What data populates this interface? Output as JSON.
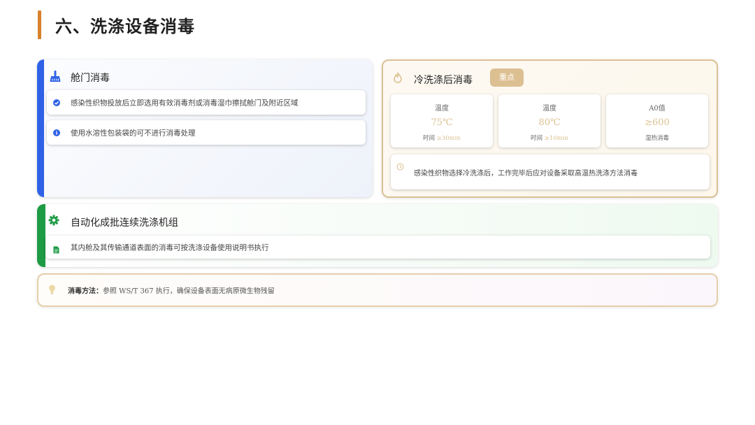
{
  "page": {
    "title": "六、洗涤设备消毒"
  },
  "hatch": {
    "title": "舱门消毒",
    "items": [
      {
        "text": "感染性织物投放后立即选用有效消毒剂或消毒湿巾擦拭舱门及附近区域"
      },
      {
        "text": "使用水溶性包装袋的可不进行消毒处理"
      }
    ]
  },
  "hot": {
    "title": "冷洗涤后消毒",
    "badge": "重点",
    "metrics": [
      {
        "label": "温度",
        "value": "75℃",
        "sub_label": "时间",
        "sub_value": "≥30min"
      },
      {
        "label": "温度",
        "value": "80℃",
        "sub_label": "时间",
        "sub_value": "≥10min"
      },
      {
        "label": "A0值",
        "value": "≥600",
        "sub_label": "湿热消毒",
        "sub_value": ""
      }
    ],
    "note": "感染性织物选择冷洗涤后，工作完毕后应对设备采取高温热洗涤方法消毒"
  },
  "auto": {
    "title": "自动化成批连续洗涤机组",
    "item": "其内舱及其传输通道表面的消毒可按洗涤设备使用说明书执行"
  },
  "method": {
    "label": "消毒方法：",
    "text": "参照 WS/T 367 执行，确保设备表面无病原微生物残留"
  },
  "colors": {
    "accent_orange": "#d8822b",
    "blue": "#2f62e6",
    "green": "#1e9b45",
    "gold": "#dcc092"
  },
  "icons": [
    "broom-icon",
    "check-circle-icon",
    "info-circle-icon",
    "fire-icon",
    "clock-icon",
    "gear-icon",
    "document-icon",
    "lightbulb-icon"
  ]
}
